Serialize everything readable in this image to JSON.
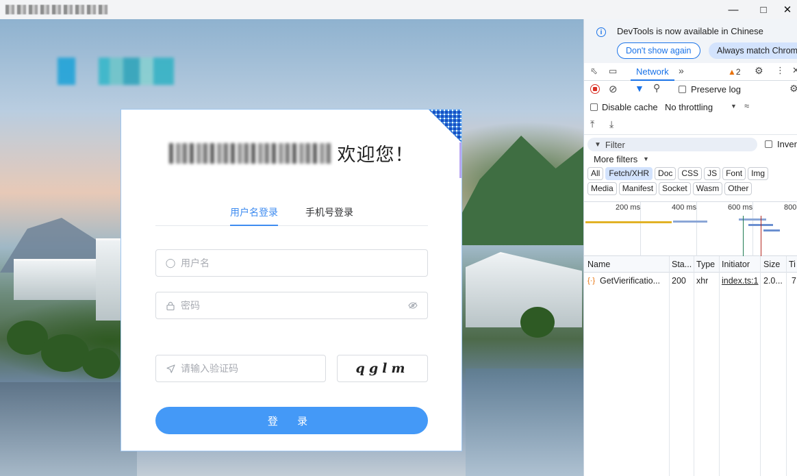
{
  "window": {
    "minimize_icon": "minimize-icon",
    "maximize_icon": "maximize-icon",
    "close_icon": "close-icon"
  },
  "login": {
    "welcome": "欢迎您！",
    "tabs": [
      {
        "label": "用户名登录",
        "active": true
      },
      {
        "label": "手机号登录",
        "active": false
      }
    ],
    "username_placeholder": "用户名",
    "password_placeholder": "密码",
    "captcha_placeholder": "请输入验证码",
    "captcha_text": "qglm",
    "login_button": "登 录",
    "accent_color": "#4499f7"
  },
  "devtools": {
    "banner": {
      "message": "DevTools is now available in Chinese",
      "dont_show": "Don't show again",
      "always_match": "Always match Chrom"
    },
    "tabs": {
      "network": "Network",
      "warning_count": "2"
    },
    "toolbar": {
      "preserve_log": "Preserve log",
      "disable_cache": "Disable cache",
      "throttling": "No throttling"
    },
    "filter": {
      "placeholder": "Filter",
      "invert": "Inver",
      "more_filters": "More filters"
    },
    "type_filters_row1": [
      "All",
      "Fetch/XHR",
      "Doc",
      "CSS",
      "JS",
      "Font",
      "Img"
    ],
    "type_filters_row2": [
      "Media",
      "Manifest",
      "Socket",
      "Wasm",
      "Other"
    ],
    "active_filter": "Fetch/XHR",
    "timeline_labels": [
      "200 ms",
      "400 ms",
      "600 ms",
      "800"
    ],
    "table": {
      "columns": [
        "Name",
        "Sta...",
        "Type",
        "Initiator",
        "Size",
        "Ti"
      ],
      "rows": [
        {
          "name": "GetVierificatio...",
          "status": "200",
          "type": "xhr",
          "initiator": "index.ts:1",
          "size": "2.0...",
          "time": "7"
        }
      ]
    }
  }
}
